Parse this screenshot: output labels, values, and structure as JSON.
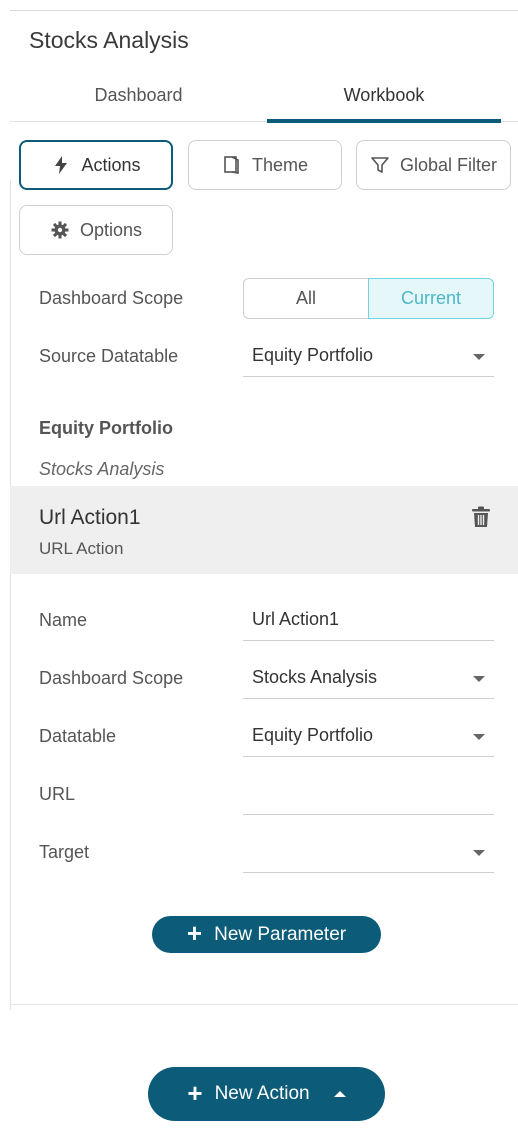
{
  "panel": {
    "title": "Stocks Analysis"
  },
  "tabs": [
    {
      "label": "Dashboard",
      "active": false
    },
    {
      "label": "Workbook",
      "active": true
    }
  ],
  "toolbar": {
    "actions_label": "Actions",
    "theme_label": "Theme",
    "global_filter_label": "Global Filter",
    "options_label": "Options",
    "active": "Actions"
  },
  "scope": {
    "label": "Dashboard Scope",
    "options": [
      "All",
      "Current"
    ],
    "selected": "Current"
  },
  "source": {
    "label": "Source Datatable",
    "value": "Equity Portfolio"
  },
  "group": {
    "title": "Equity Portfolio",
    "subtitle": "Stocks Analysis"
  },
  "action_item": {
    "name": "Url Action1",
    "type": "URL Action"
  },
  "form": {
    "name_label": "Name",
    "name_value": "Url Action1",
    "dashboard_scope_label": "Dashboard Scope",
    "dashboard_scope_value": "Stocks Analysis",
    "datatable_label": "Datatable",
    "datatable_value": "Equity Portfolio",
    "url_label": "URL",
    "url_value": "",
    "target_label": "Target",
    "target_value": ""
  },
  "buttons": {
    "new_parameter": "New Parameter",
    "new_action": "New Action"
  },
  "colors": {
    "accent": "#0c5b78",
    "segment_selected_bg": "#e5f7f9",
    "segment_selected_text": "#4bb8c6"
  }
}
